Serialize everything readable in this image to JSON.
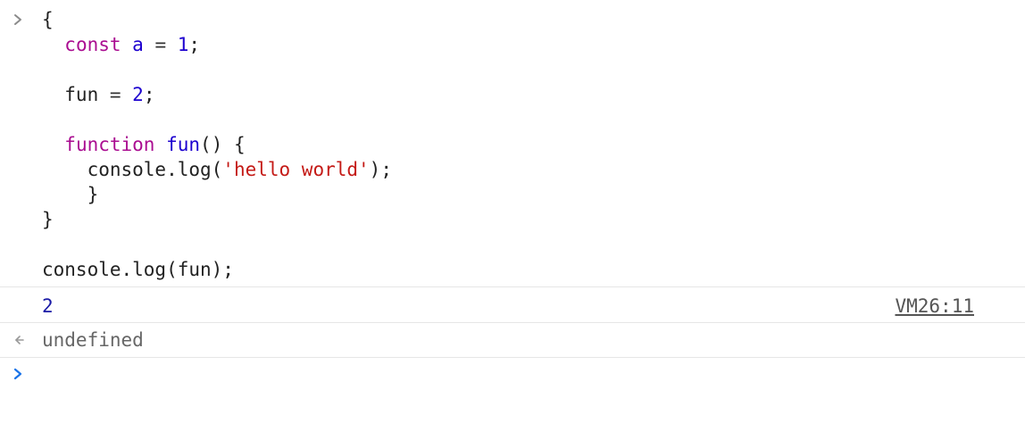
{
  "console": {
    "input": {
      "lines": [
        [
          {
            "t": "{",
            "c": "plain"
          }
        ],
        [
          {
            "t": "  ",
            "c": "plain"
          },
          {
            "t": "const",
            "c": "kw"
          },
          {
            "t": " ",
            "c": "plain"
          },
          {
            "t": "a",
            "c": "var"
          },
          {
            "t": " = ",
            "c": "op"
          },
          {
            "t": "1",
            "c": "num"
          },
          {
            "t": ";",
            "c": "plain"
          }
        ],
        [],
        [
          {
            "t": "  fun",
            "c": "plain"
          },
          {
            "t": " = ",
            "c": "op"
          },
          {
            "t": "2",
            "c": "num"
          },
          {
            "t": ";",
            "c": "plain"
          }
        ],
        [],
        [
          {
            "t": "  ",
            "c": "plain"
          },
          {
            "t": "function",
            "c": "kw"
          },
          {
            "t": " ",
            "c": "plain"
          },
          {
            "t": "fun",
            "c": "var"
          },
          {
            "t": "() {",
            "c": "plain"
          }
        ],
        [
          {
            "t": "    console.log(",
            "c": "plain"
          },
          {
            "t": "'hello world'",
            "c": "str"
          },
          {
            "t": ");",
            "c": "plain"
          }
        ],
        [
          {
            "t": "    }",
            "c": "plain"
          }
        ],
        [
          {
            "t": "}",
            "c": "plain"
          }
        ],
        [],
        [
          {
            "t": "console.log(fun);",
            "c": "plain"
          }
        ]
      ]
    },
    "log": {
      "value": "2",
      "source": "VM26:11"
    },
    "result": {
      "value": "undefined"
    },
    "icons": {
      "input_prompt": "chevron-right-icon",
      "result_marker": "return-arrow-icon",
      "active_prompt": "chevron-right-icon"
    },
    "colors": {
      "keyword": "#aa0d91",
      "number": "#1c00cf",
      "string": "#c41a16",
      "prompt_active": "#1a73e8"
    }
  }
}
